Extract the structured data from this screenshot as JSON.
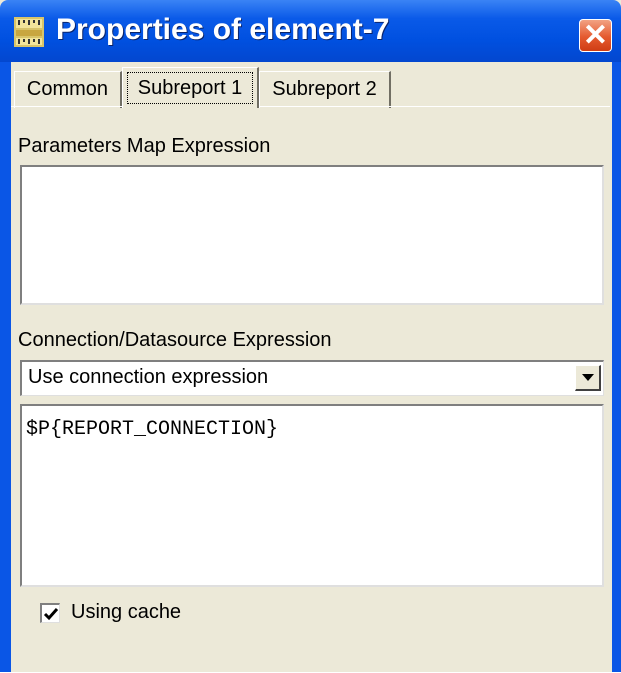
{
  "window": {
    "title": "Properties of element-7",
    "icon": "ruler-properties-icon",
    "close_icon": "close-icon",
    "titlebar_color": "#0a56e6",
    "close_color": "#e55a2f"
  },
  "tabs": [
    {
      "label": "Common",
      "active": false
    },
    {
      "label": "Subreport 1",
      "active": true
    },
    {
      "label": "Subreport 2",
      "active": false
    }
  ],
  "form": {
    "parameters_map_label": "Parameters Map Expression",
    "parameters_map_value": "",
    "connection_label": "Connection/Datasource Expression",
    "connection_type": "Use connection expression",
    "connection_expression": "$P{REPORT_CONNECTION}",
    "using_cache_label": "Using cache",
    "using_cache_checked": true
  }
}
